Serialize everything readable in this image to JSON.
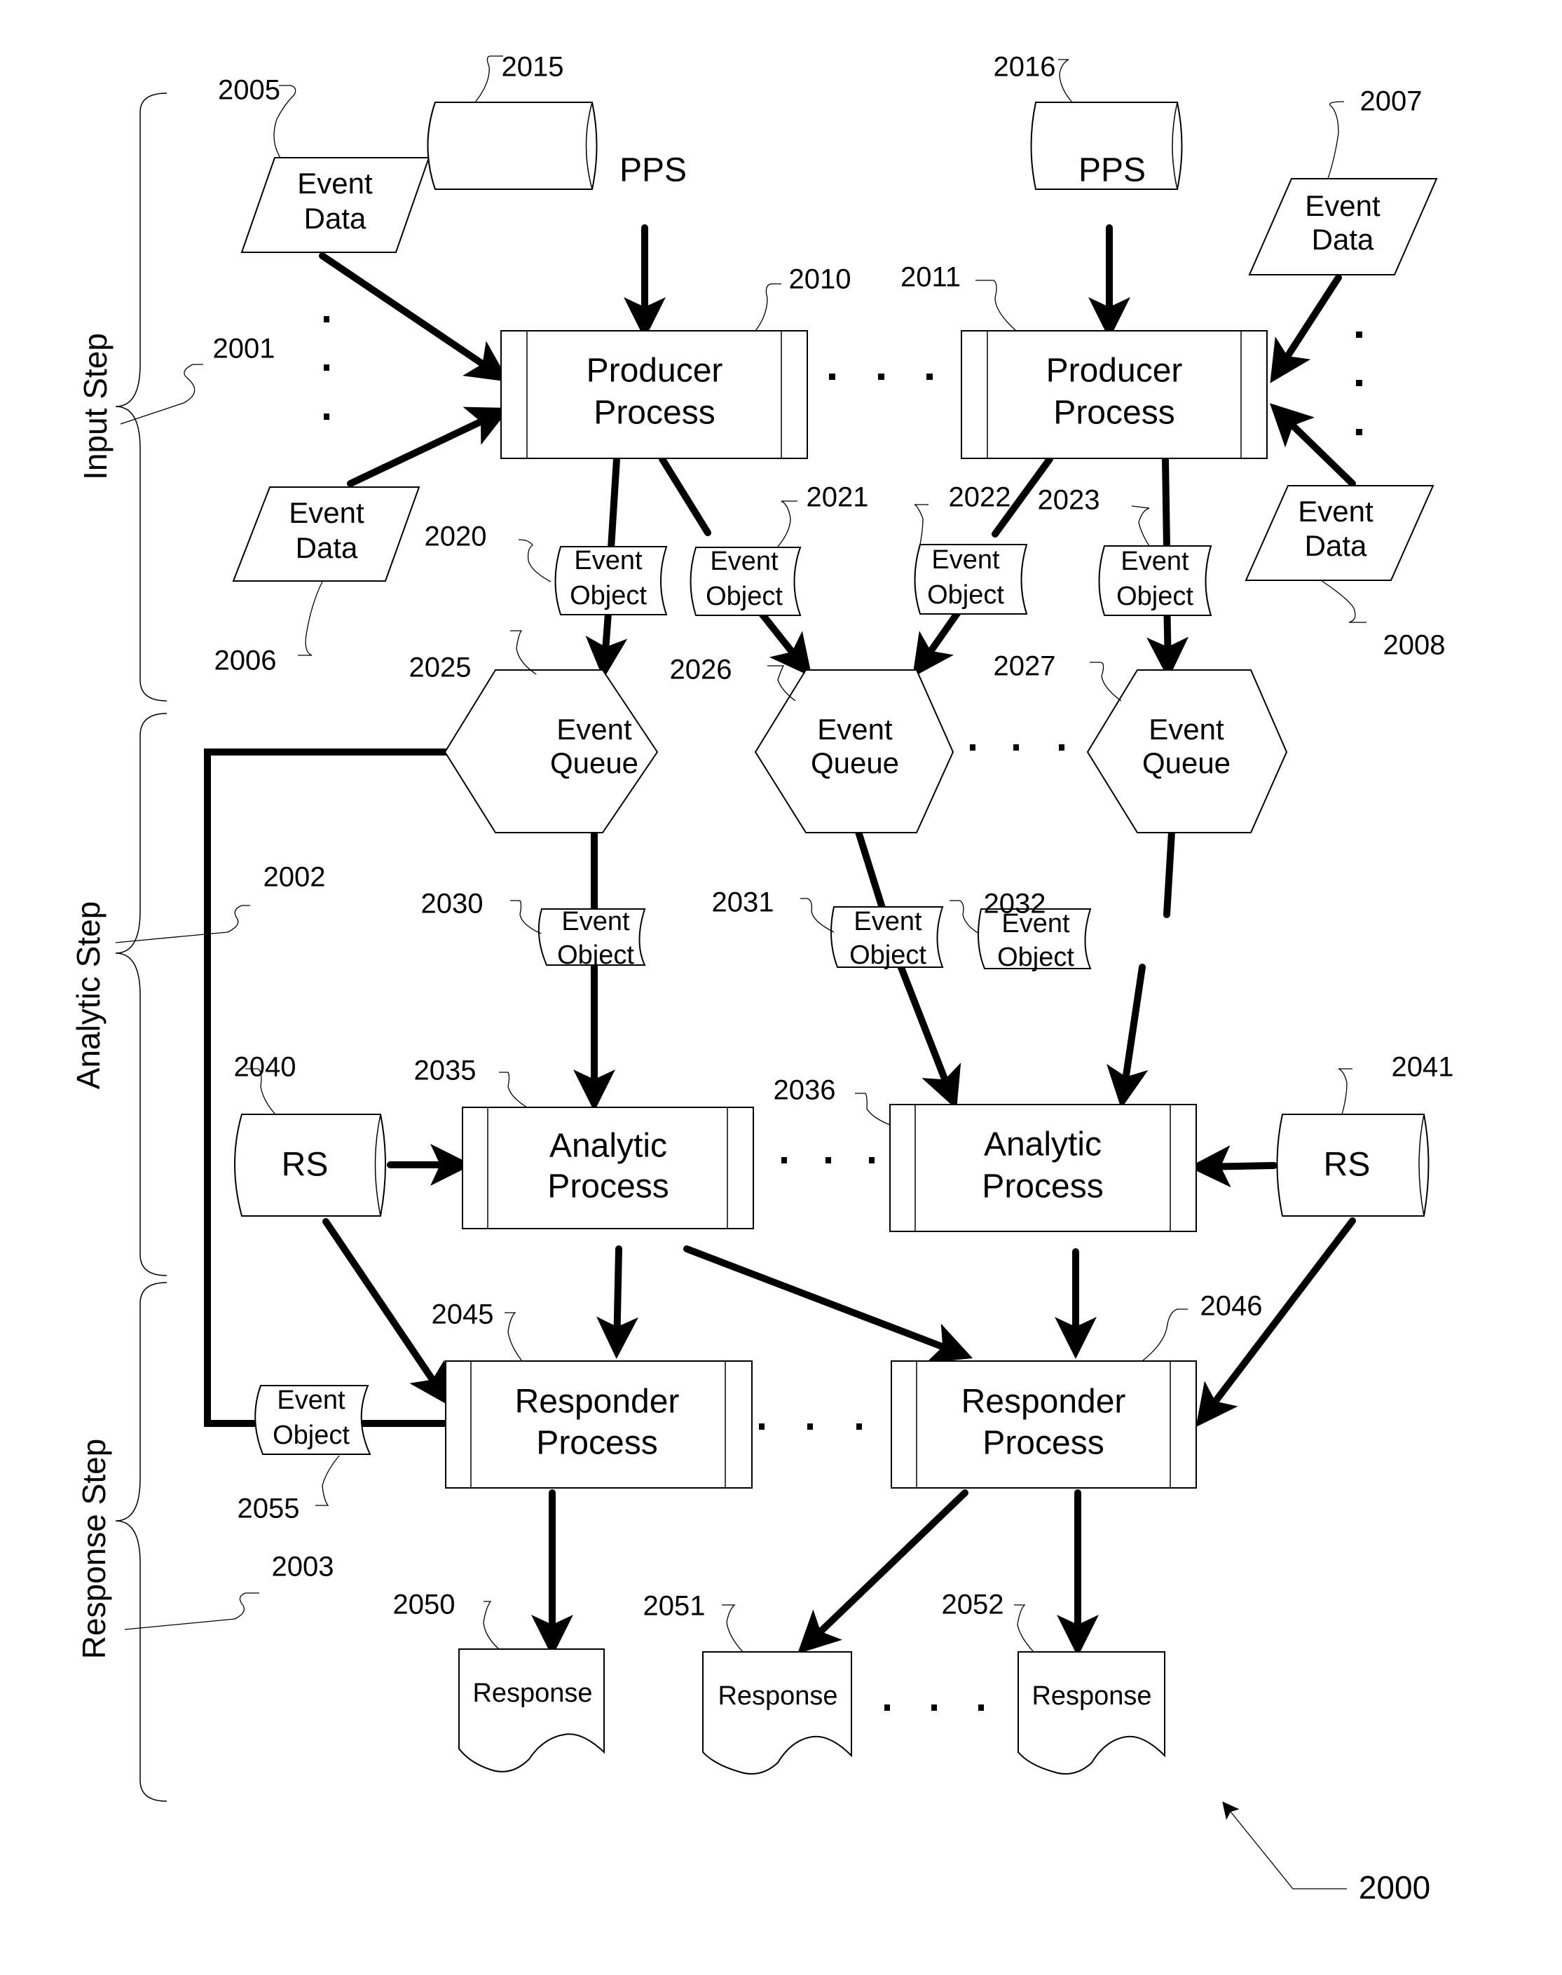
{
  "figure": {
    "reference": "2000",
    "steps": [
      {
        "ref": "2001",
        "label": "Input Step"
      },
      {
        "ref": "2002",
        "label": "Analytic Step"
      },
      {
        "ref": "2003",
        "label": "Response Step"
      }
    ]
  },
  "nodes": {
    "ed2005": {
      "ref": "2005",
      "type": "data",
      "lines": [
        "Event",
        "Data"
      ]
    },
    "ed2006": {
      "ref": "2006",
      "type": "data",
      "lines": [
        "Event",
        "Data"
      ]
    },
    "ed2007": {
      "ref": "2007",
      "type": "data",
      "lines": [
        "Event",
        "Data"
      ]
    },
    "ed2008": {
      "ref": "2008",
      "type": "data",
      "lines": [
        "Event",
        "Data"
      ]
    },
    "pps2015": {
      "ref": "2015",
      "type": "storage",
      "lines": [
        "PPS"
      ]
    },
    "pps2016": {
      "ref": "2016",
      "type": "storage",
      "lines": [
        "PPS"
      ]
    },
    "pp2010": {
      "ref": "2010",
      "type": "process",
      "lines": [
        "Producer",
        "Process"
      ]
    },
    "pp2011": {
      "ref": "2011",
      "type": "process",
      "lines": [
        "Producer",
        "Process"
      ]
    },
    "eo2020": {
      "ref": "2020",
      "type": "object",
      "lines": [
        "Event",
        "Object"
      ]
    },
    "eo2021": {
      "ref": "2021",
      "type": "object",
      "lines": [
        "Event",
        "Object"
      ]
    },
    "eo2022": {
      "ref": "2022",
      "type": "object",
      "lines": [
        "Event",
        "Object"
      ]
    },
    "eo2023": {
      "ref": "2023",
      "type": "object",
      "lines": [
        "Event",
        "Object"
      ]
    },
    "eq2025": {
      "ref": "2025",
      "type": "queue",
      "lines": [
        "Event",
        "Queue"
      ]
    },
    "eq2026": {
      "ref": "2026",
      "type": "queue",
      "lines": [
        "Event",
        "Queue"
      ]
    },
    "eq2027": {
      "ref": "2027",
      "type": "queue",
      "lines": [
        "Event",
        "Queue"
      ]
    },
    "eo2030": {
      "ref": "2030",
      "type": "object",
      "lines": [
        "Event",
        "Object"
      ]
    },
    "eo2031": {
      "ref": "2031",
      "type": "object",
      "lines": [
        "Event",
        "Object"
      ]
    },
    "eo2032": {
      "ref": "2032",
      "type": "object",
      "lines": [
        "Event",
        "Object"
      ]
    },
    "ap2035": {
      "ref": "2035",
      "type": "process",
      "lines": [
        "Analytic",
        "Process"
      ]
    },
    "ap2036": {
      "ref": "2036",
      "type": "process",
      "lines": [
        "Analytic",
        "Process"
      ]
    },
    "rs2040": {
      "ref": "2040",
      "type": "storage",
      "lines": [
        "RS"
      ]
    },
    "rs2041": {
      "ref": "2041",
      "type": "storage",
      "lines": [
        "RS"
      ]
    },
    "rp2045": {
      "ref": "2045",
      "type": "process",
      "lines": [
        "Responder",
        "Process"
      ]
    },
    "rp2046": {
      "ref": "2046",
      "type": "process",
      "lines": [
        "Responder",
        "Process"
      ]
    },
    "r2050": {
      "ref": "2050",
      "type": "document",
      "lines": [
        "Response"
      ]
    },
    "r2051": {
      "ref": "2051",
      "type": "document",
      "lines": [
        "Response"
      ]
    },
    "r2052": {
      "ref": "2052",
      "type": "document",
      "lines": [
        "Response"
      ]
    },
    "eo2055": {
      "ref": "2055",
      "type": "object",
      "lines": [
        "Event",
        "Object"
      ]
    }
  },
  "edges": [
    {
      "from": "2005",
      "to": "2010"
    },
    {
      "from": "2006",
      "to": "2010"
    },
    {
      "from": "2015",
      "to": "2010"
    },
    {
      "from": "2016",
      "to": "2011"
    },
    {
      "from": "2007",
      "to": "2011"
    },
    {
      "from": "2008",
      "to": "2011"
    },
    {
      "from": "2010",
      "to": "2025",
      "via": "2020"
    },
    {
      "from": "2010",
      "to": "2026",
      "via": "2021"
    },
    {
      "from": "2011",
      "to": "2026",
      "via": "2022"
    },
    {
      "from": "2011",
      "to": "2027",
      "via": "2023"
    },
    {
      "from": "2025",
      "to": "2035",
      "via": "2030"
    },
    {
      "from": "2026",
      "to": "2036",
      "via": "2031"
    },
    {
      "from": "2027",
      "to": "2036",
      "via": "2032"
    },
    {
      "from": "2040",
      "to": "2035"
    },
    {
      "from": "2041",
      "to": "2036"
    },
    {
      "from": "2040",
      "to": "2045"
    },
    {
      "from": "2035",
      "to": "2045"
    },
    {
      "from": "2035",
      "to": "2046"
    },
    {
      "from": "2036",
      "to": "2046"
    },
    {
      "from": "2041",
      "to": "2046"
    },
    {
      "from": "2045",
      "to": "2050"
    },
    {
      "from": "2046",
      "to": "2051"
    },
    {
      "from": "2046",
      "to": "2052"
    },
    {
      "from": "2045",
      "to": "2025",
      "via": "2055"
    }
  ],
  "ellipsis": "· · ·"
}
